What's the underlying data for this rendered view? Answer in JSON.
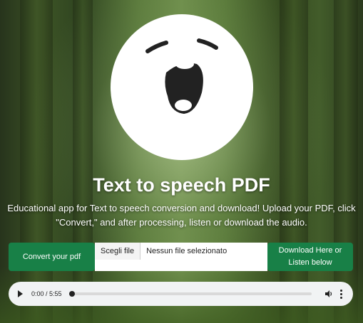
{
  "app": {
    "title": "Text to speech PDF",
    "description": "Educational app for Text to speech conversion and download! Upload your PDF, click \"Convert,\" and after processing, listen or download the audio."
  },
  "controls": {
    "convert_label": "Convert your pdf",
    "file_button_label": "Scegli file",
    "file_status": "Nessun file selezionato",
    "download_label": "Download Here or Listen below"
  },
  "audio": {
    "time_display": "0:00 / 5:55",
    "progress": 0,
    "play_icon": "play-icon",
    "volume_icon": "volume-icon",
    "more_icon": "more-options-icon"
  },
  "colors": {
    "accent": "#188047",
    "logo_bg": "#ffffff",
    "logo_face": "#222222"
  }
}
